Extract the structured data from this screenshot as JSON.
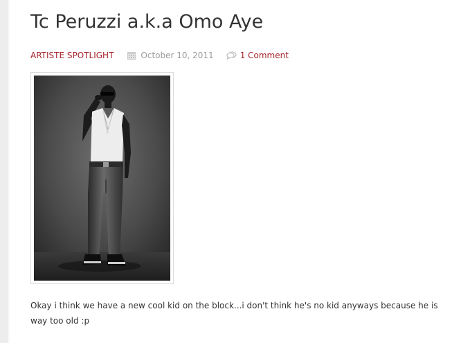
{
  "post": {
    "title": "Tc Peruzzi a.k.a Omo Aye",
    "category": "ARTISTE SPOTLIGHT",
    "date": "October 10, 2011",
    "comments": "1 Comment",
    "body": "Okay i think we have a new cool kid on the block...i don't think he's no kid anyways because he is way too old :p",
    "photo_icon": "artist-photo-image"
  },
  "theme": {
    "link_color": "#a5232a",
    "meta_gray": "#9a9a9a",
    "text_color": "#333333"
  }
}
